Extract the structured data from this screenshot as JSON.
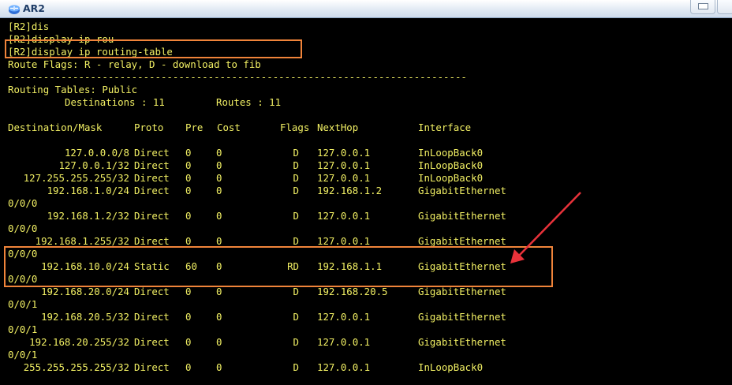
{
  "window": {
    "title": "AR2",
    "colors": {
      "terminal_bg": "#000000",
      "terminal_text": "#f2f064",
      "highlight": "#f0843a",
      "arrow": "#e8323a"
    }
  },
  "console": {
    "cmd1": "[R2]dis",
    "cmd2": "[R2]display ip rou",
    "cmd3": "[R2]display ip routing-table",
    "flags_legend": "Route Flags: R - relay, D - download to fib",
    "separator": "------------------------------------------------------------------------------",
    "tables_label": "Routing Tables: Public",
    "destinations_label": "Destinations : 11",
    "routes_label": "Routes : 11"
  },
  "route_table": {
    "headers": {
      "dest": "Destination/Mask",
      "proto": "Proto",
      "pre": "Pre",
      "cost": "Cost",
      "flags": "Flags",
      "nexthop": "NextHop",
      "iface": "Interface"
    },
    "rows": [
      {
        "dest": "127.0.0.0/8",
        "proto": "Direct",
        "pre": "0",
        "cost": "0",
        "flags": "D",
        "nexthop": "127.0.0.1",
        "iface": "InLoopBack0",
        "cont": ""
      },
      {
        "dest": "127.0.0.1/32",
        "proto": "Direct",
        "pre": "0",
        "cost": "0",
        "flags": "D",
        "nexthop": "127.0.0.1",
        "iface": "InLoopBack0",
        "cont": ""
      },
      {
        "dest": "127.255.255.255/32",
        "proto": "Direct",
        "pre": "0",
        "cost": "0",
        "flags": "D",
        "nexthop": "127.0.0.1",
        "iface": "InLoopBack0",
        "cont": ""
      },
      {
        "dest": "192.168.1.0/24",
        "proto": "Direct",
        "pre": "0",
        "cost": "0",
        "flags": "D",
        "nexthop": "192.168.1.2",
        "iface": "GigabitEthernet",
        "cont": "0/0/0"
      },
      {
        "dest": "192.168.1.2/32",
        "proto": "Direct",
        "pre": "0",
        "cost": "0",
        "flags": "D",
        "nexthop": "127.0.0.1",
        "iface": "GigabitEthernet",
        "cont": "0/0/0"
      },
      {
        "dest": "192.168.1.255/32",
        "proto": "Direct",
        "pre": "0",
        "cost": "0",
        "flags": "D",
        "nexthop": "127.0.0.1",
        "iface": "GigabitEthernet",
        "cont": "0/0/0"
      },
      {
        "dest": "192.168.10.0/24",
        "proto": "Static",
        "pre": "60",
        "cost": "0",
        "flags": "RD",
        "nexthop": "192.168.1.1",
        "iface": "GigabitEthernet",
        "cont": "0/0/0"
      },
      {
        "dest": "192.168.20.0/24",
        "proto": "Direct",
        "pre": "0",
        "cost": "0",
        "flags": "D",
        "nexthop": "192.168.20.5",
        "iface": "GigabitEthernet",
        "cont": "0/0/1"
      },
      {
        "dest": "192.168.20.5/32",
        "proto": "Direct",
        "pre": "0",
        "cost": "0",
        "flags": "D",
        "nexthop": "127.0.0.1",
        "iface": "GigabitEthernet",
        "cont": "0/0/1"
      },
      {
        "dest": "192.168.20.255/32",
        "proto": "Direct",
        "pre": "0",
        "cost": "0",
        "flags": "D",
        "nexthop": "127.0.0.1",
        "iface": "GigabitEthernet",
        "cont": "0/0/1"
      },
      {
        "dest": "255.255.255.255/32",
        "proto": "Direct",
        "pre": "0",
        "cost": "0",
        "flags": "D",
        "nexthop": "127.0.0.1",
        "iface": "InLoopBack0",
        "cont": ""
      }
    ]
  }
}
